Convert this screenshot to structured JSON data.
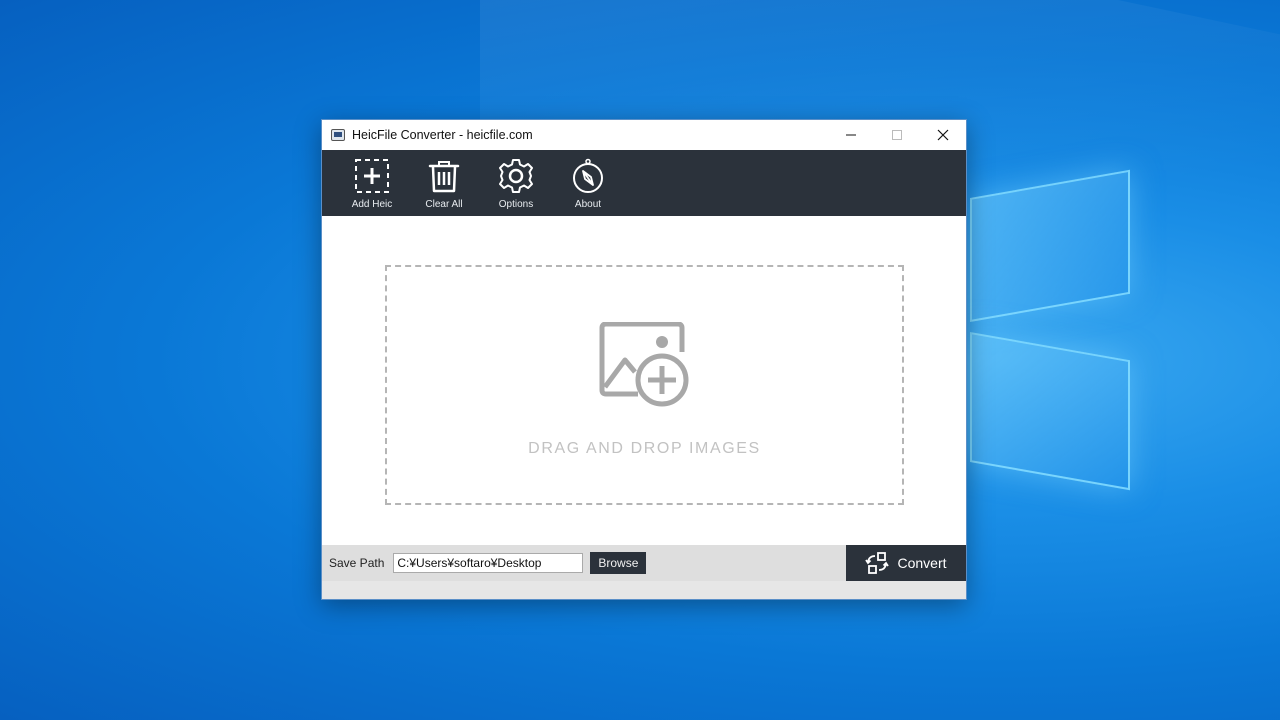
{
  "window": {
    "title": "HeicFile Converter - heicfile.com",
    "controls": {
      "minimize": "—",
      "maximize": "☐",
      "close": "✕"
    }
  },
  "toolbar": {
    "items": [
      {
        "label": "Add Heic",
        "icon": "add-dashed-square-icon"
      },
      {
        "label": "Clear All",
        "icon": "trash-icon"
      },
      {
        "label": "Options",
        "icon": "gear-icon"
      },
      {
        "label": "About",
        "icon": "compass-icon"
      }
    ]
  },
  "dropzone": {
    "icon": "add-image-icon",
    "text": "DRAG AND DROP IMAGES"
  },
  "bottombar": {
    "save_path_label": "Save Path",
    "save_path_value": "C:¥Users¥softaro¥Desktop",
    "browse_label": "Browse",
    "convert_label": "Convert",
    "convert_icon": "convert-arrows-icon"
  },
  "colors": {
    "toolbar_bg": "#2b323b",
    "dropzone_border": "#b5b5b5",
    "bottombar_bg": "#dedede",
    "desktop_bg": "#0a78d6"
  }
}
